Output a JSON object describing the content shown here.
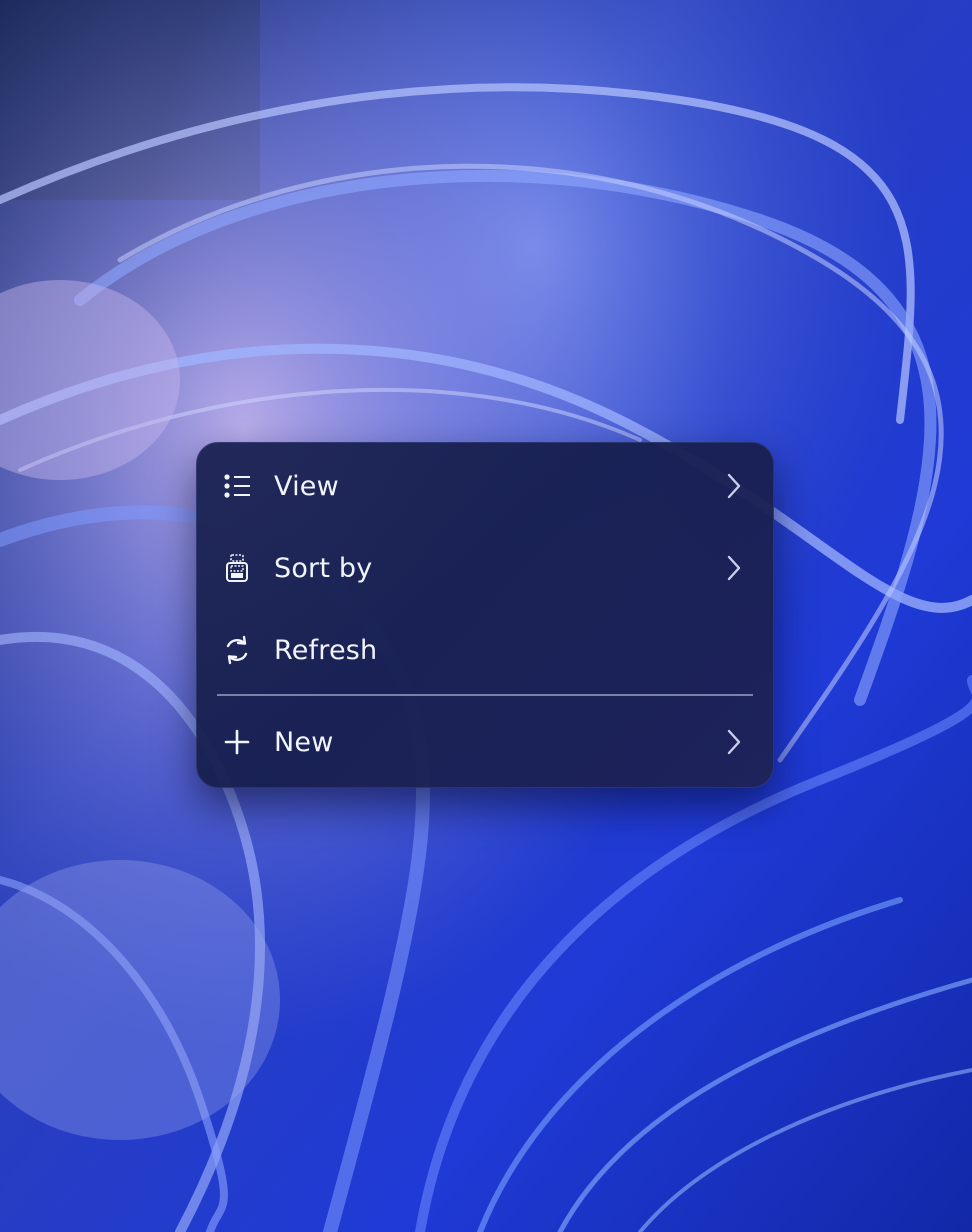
{
  "desktop": {
    "wallpaper": "Windows 11 bloom wallpaper"
  },
  "context_menu": {
    "items": [
      {
        "label": "View",
        "icon": "list-view-icon",
        "has_submenu": true
      },
      {
        "label": "Sort by",
        "icon": "sort-icon",
        "has_submenu": true
      },
      {
        "label": "Refresh",
        "icon": "refresh-icon",
        "has_submenu": false
      },
      {
        "label": "New",
        "icon": "plus-icon",
        "has_submenu": true
      }
    ]
  },
  "colors": {
    "menu_background": "#1c2454",
    "menu_text": "#f2f4fb",
    "wallpaper_primary": "#2a45d6",
    "wallpaper_dark": "#0f1f4a"
  }
}
